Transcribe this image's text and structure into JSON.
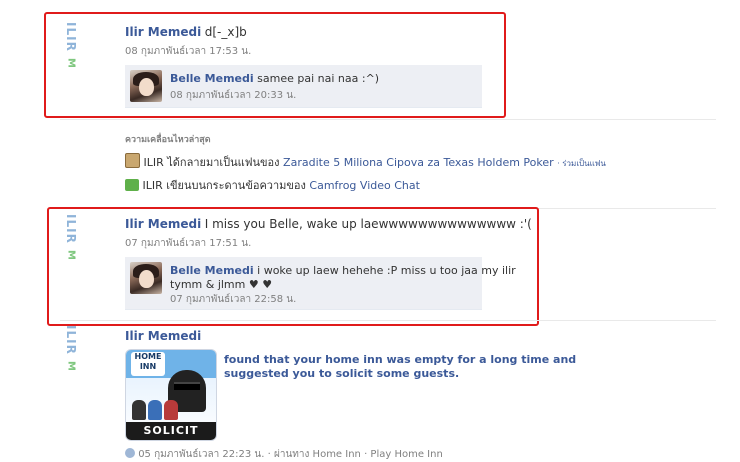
{
  "colors": {
    "link": "#3b5998",
    "annotation_red": "#e01b1b",
    "comment_bg": "#edeff4",
    "muted": "#808080"
  },
  "posts": [
    {
      "logo_text": "ILIR",
      "logo_mark": "M",
      "author": "Ilir Memedi",
      "message": "d[-_x]b",
      "time": "08 กุมภาพันธ์เวลา 17:53 น.",
      "comment": {
        "author": "Belle Memedi",
        "text": "samee pai nai naa :^)",
        "time": "08 กุมภาพันธ์เวลา 20:33 น."
      }
    },
    {
      "logo_text": "ILIR",
      "logo_mark": "M",
      "author": "Ilir Memedi",
      "message": "I miss you Belle, wake up laewwwwwwwwwwwwww :'(",
      "time": "07 กุมภาพันธ์เวลา 17:51 น.",
      "comment": {
        "author": "Belle Memedi",
        "text": "i woke up laew hehehe :P miss u too jaa my ilir",
        "text2": "tymm & jlmm ♥ ♥",
        "time": "07 กุมภาพันธ์เวลา 22:58 น."
      }
    },
    {
      "logo_text": "ILIR",
      "logo_mark": "M",
      "author": "Ilir Memedi",
      "story_line1": "found that your home inn was empty for a long time and",
      "story_line2": "suggested you to solicit some guests.",
      "app_logo_line1": "HOME",
      "app_logo_line2": "INN",
      "app_banner": "SOLICIT",
      "footer_cut": "05 กุมภาพันธ์เวลา 22:23 น. · ผ่านทาง Home Inn · Play Home Inn"
    }
  ],
  "recent_activity": {
    "title": "ความเคลื่อนไหวล่าสุด",
    "items": [
      {
        "icon": "fan-page-icon",
        "prefix": "ILIR ได้กลายมาเป็นแฟนของ",
        "link": "Zaradite 5 Miliona Cipova za Texas Holdem Poker",
        "suffix": "· ร่วมเป็นแฟน"
      },
      {
        "icon": "wall-post-icon",
        "prefix": "ILIR เขียนบนกระดานข้อความของ",
        "link": "Camfrog Video Chat"
      }
    ]
  }
}
